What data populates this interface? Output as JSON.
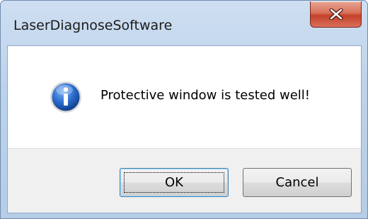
{
  "window": {
    "title": "LaserDiagnoseSoftware",
    "close_icon": "close-x-icon"
  },
  "message": {
    "icon": "info-icon",
    "text": "Protective window is tested well!"
  },
  "buttons": {
    "ok_label": "OK",
    "cancel_label": "Cancel"
  },
  "colors": {
    "frame": "#bcd2ea",
    "close_button": "#c4412a",
    "info_icon": "#1f5fb8",
    "button_area": "#f0f0f0"
  }
}
